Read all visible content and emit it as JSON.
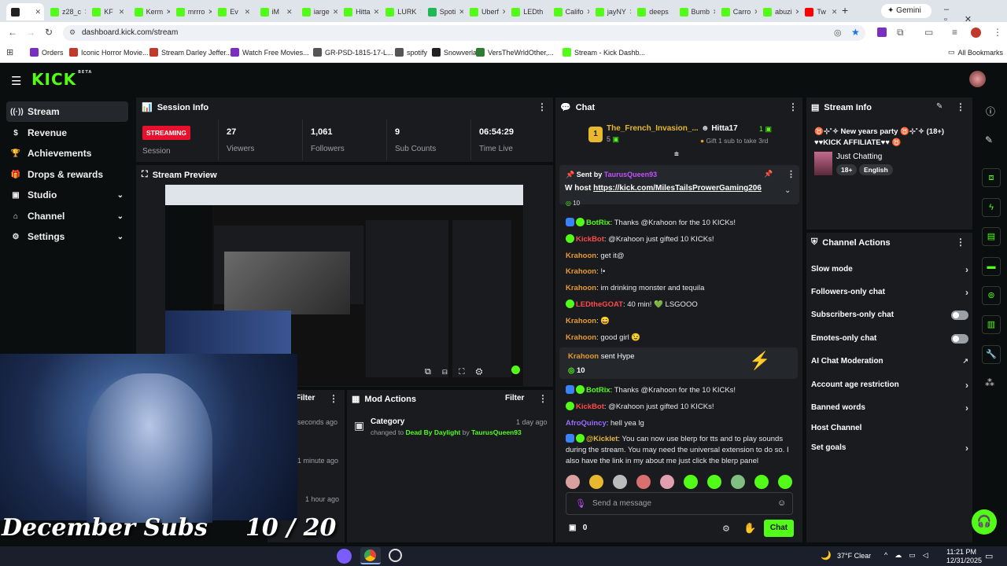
{
  "browser": {
    "tabs": [
      {
        "label": "",
        "color": "#222"
      },
      {
        "label": "z28_c",
        "color": "#53fc18"
      },
      {
        "label": "KF",
        "color": "#53fc18"
      },
      {
        "label": "Kerm",
        "color": "#53fc18"
      },
      {
        "label": "mrrro",
        "color": "#53fc18"
      },
      {
        "label": "Ev",
        "color": "#53fc18"
      },
      {
        "label": "iM",
        "color": "#53fc18"
      },
      {
        "label": "iarge",
        "color": "#53fc18"
      },
      {
        "label": "Hitta",
        "color": "#53fc18"
      },
      {
        "label": "LURK",
        "color": "#53fc18"
      },
      {
        "label": "Spoti",
        "color": "#1db954"
      },
      {
        "label": "Uberf",
        "color": "#53fc18"
      },
      {
        "label": "LEDth",
        "color": "#53fc18"
      },
      {
        "label": "Califo",
        "color": "#53fc18"
      },
      {
        "label": "jayNY",
        "color": "#53fc18"
      },
      {
        "label": "deeps",
        "color": "#53fc18"
      },
      {
        "label": "Bumb",
        "color": "#53fc18"
      },
      {
        "label": "Carro",
        "color": "#53fc18"
      },
      {
        "label": "abuzi",
        "color": "#53fc18"
      },
      {
        "label": "Tw",
        "color": "#ff0000"
      }
    ],
    "gemini_label": "Gemini",
    "url": "dashboard.kick.com/stream",
    "bookmarks": [
      "Orders",
      "Iconic Horror Movie...",
      "Stream Darley Jeffer...",
      "Watch Free Movies...",
      "GR-PSD-1815-17-L...",
      "spotify",
      "Snowverlay",
      "VersTheWrldOther,...",
      "Stream - Kick Dashb..."
    ],
    "all_bookmarks": "All Bookmarks"
  },
  "kick": {
    "logo": "KICK",
    "beta": "BETA"
  },
  "sidebar": {
    "items": [
      {
        "label": "Stream",
        "icon": "stream-icon"
      },
      {
        "label": "Revenue",
        "icon": "revenue-icon"
      },
      {
        "label": "Achievements",
        "icon": "trophy-icon"
      },
      {
        "label": "Drops & rewards",
        "icon": "gift-icon"
      },
      {
        "label": "Studio",
        "icon": "studio-icon"
      },
      {
        "label": "Channel",
        "icon": "channel-icon"
      },
      {
        "label": "Settings",
        "icon": "gear-icon"
      }
    ]
  },
  "session": {
    "title": "Session Info",
    "status": "STREAMING",
    "status_label": "Session",
    "stats": [
      {
        "value": "27",
        "label": "Viewers"
      },
      {
        "value": "1,061",
        "label": "Followers"
      },
      {
        "value": "9",
        "label": "Sub Counts"
      },
      {
        "value": "06:54:29",
        "label": "Time Live"
      }
    ]
  },
  "preview": {
    "title": "Stream Preview"
  },
  "activity": {
    "filter_label": "Filter",
    "times": [
      "seconds ago",
      "1 minute ago",
      "1 hour ago"
    ]
  },
  "mod_actions": {
    "title": "Mod Actions",
    "filter_label": "Filter",
    "entry": {
      "title": "Category",
      "changed_to": "changed to",
      "category": "Dead By Daylight",
      "by": "by",
      "user": "TaurusQueen93",
      "time": "1 day ago"
    }
  },
  "chat": {
    "title": "Chat",
    "leader": {
      "rank": "1",
      "name": "The_French_Invasion_...",
      "count": "5"
    },
    "gifter": {
      "name": "Hitta17",
      "count": "1",
      "goal": "Gift 1 sub to take 3rd"
    },
    "pinned": {
      "sent_by": "Sent by",
      "user": "TaurusQueen93",
      "text_prefix": "W host ",
      "link": "https://kick.com/MilesTailsProwerGaming206"
    },
    "partial_value": "10",
    "messages": [
      {
        "user": "BotRix",
        "color": "#53fc18",
        "text": ": Thanks @Krahoon for the 10 KICKs!"
      },
      {
        "user": "KickBot",
        "color": "#ff4a4a",
        "text": ": @Krahoon just gifted 10 KICKs!"
      },
      {
        "user": "Krahoon",
        "color": "#e89b2e",
        "text": ": get it@"
      },
      {
        "user": "Krahoon",
        "color": "#e89b2e",
        "text": ": !•"
      },
      {
        "user": "Krahoon",
        "color": "#e89b2e",
        "text": ": im drinking monster and tequila"
      },
      {
        "user": "LEDtheGOAT",
        "color": "#ff4a4a",
        "text": ": 40 min! 💚 LSGOOO"
      },
      {
        "user": "Krahoon",
        "color": "#e89b2e",
        "text": ": 😄"
      },
      {
        "user": "Krahoon",
        "color": "#e89b2e",
        "text": ": good girl 😉"
      }
    ],
    "hype": {
      "user": "Krahoon",
      "text": "sent Hype",
      "value": "10"
    },
    "messages2": [
      {
        "user": "BotRix",
        "color": "#53fc18",
        "text": ": Thanks @Krahoon for the 10 KICKs!"
      },
      {
        "user": "KickBot",
        "color": "#ff4a4a",
        "text": ": @Krahoon just gifted 10 KICKs!"
      },
      {
        "user": "AfroQuincy",
        "color": "#9a6bff",
        "text": ": hell yea lg"
      }
    ],
    "kicklet": {
      "user": "@Kicklet",
      "line1": ": You can now use blerp for tts and to play sounds",
      "line2": "during the stream. You may need the universal extension to do so. I",
      "line3": "also have the link in my about me just click the blerp panel"
    },
    "placeholder": "Send a message",
    "points": "0",
    "send_label": "Chat"
  },
  "stream_info": {
    "title": "Stream Info",
    "stream_title": "♉⊹˚✧ New years party ♉⊹˚✧ (18+)",
    "affiliate": "♥♥KICK AFFILIATE♥♥ ♉",
    "category": "Just Chatting",
    "tags": [
      "18+",
      "English"
    ]
  },
  "channel_actions": {
    "title": "Channel Actions",
    "items": [
      {
        "label": "Slow mode",
        "kind": "chevron"
      },
      {
        "label": "Followers-only chat",
        "kind": "chevron"
      },
      {
        "label": "Subscribers-only chat",
        "kind": "toggle"
      },
      {
        "label": "Emotes-only chat",
        "kind": "toggle"
      },
      {
        "label": "AI Chat Moderation",
        "kind": "external"
      },
      {
        "label": "Account age restriction",
        "kind": "chevron"
      },
      {
        "label": "Banned words",
        "kind": "chevron"
      },
      {
        "label": "Host Channel",
        "kind": "none"
      },
      {
        "label": "Set goals",
        "kind": "chevron"
      }
    ]
  },
  "overlay": {
    "subs_title": "December Subs",
    "subs_count": "10 / 20"
  },
  "taskbar": {
    "weather": "37°F  Clear",
    "time": "11:21 PM",
    "date": "12/31/2025"
  },
  "colors": {
    "accent": "#53fc18",
    "streaming": "#e8112d",
    "panel": "#191b1f",
    "bg": "#0b0e0f"
  }
}
